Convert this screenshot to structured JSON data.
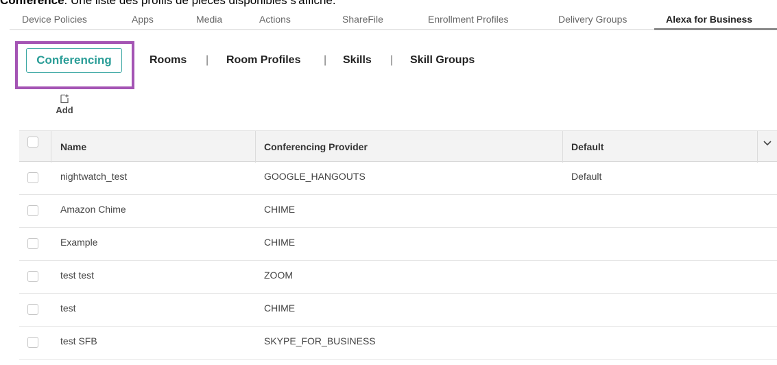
{
  "caption": {
    "bold": "Conférence",
    "text": ". Une liste des profils de pièces disponibles s'affiche."
  },
  "top_tabs": [
    {
      "label": "Device Policies",
      "active": false
    },
    {
      "label": "Apps",
      "active": false
    },
    {
      "label": "Media",
      "active": false
    },
    {
      "label": "Actions",
      "active": false
    },
    {
      "label": "ShareFile",
      "active": false
    },
    {
      "label": "Enrollment Profiles",
      "active": false
    },
    {
      "label": "Delivery Groups",
      "active": false
    },
    {
      "label": "Alexa for Business",
      "active": true
    }
  ],
  "sub_tabs": {
    "conferencing": "Conferencing",
    "rooms": "Rooms",
    "room_profiles": "Room Profiles",
    "skills": "Skills",
    "skill_groups": "Skill Groups",
    "separator": "|"
  },
  "toolbar": {
    "add_label": "Add",
    "add_icon": "add-document-icon"
  },
  "table": {
    "columns": [
      "Name",
      "Conferencing Provider",
      "Default"
    ],
    "rows": [
      {
        "name": "nightwatch_test",
        "provider": "GOOGLE_HANGOUTS",
        "default": "Default"
      },
      {
        "name": "Amazon Chime",
        "provider": "CHIME",
        "default": ""
      },
      {
        "name": "Example",
        "provider": "CHIME",
        "default": ""
      },
      {
        "name": "test test",
        "provider": "ZOOM",
        "default": ""
      },
      {
        "name": "test",
        "provider": "CHIME",
        "default": ""
      },
      {
        "name": "test SFB",
        "provider": "SKYPE_FOR_BUSINESS",
        "default": ""
      }
    ]
  },
  "colors": {
    "highlight": "#a454b4",
    "accent": "#2a9d97"
  }
}
